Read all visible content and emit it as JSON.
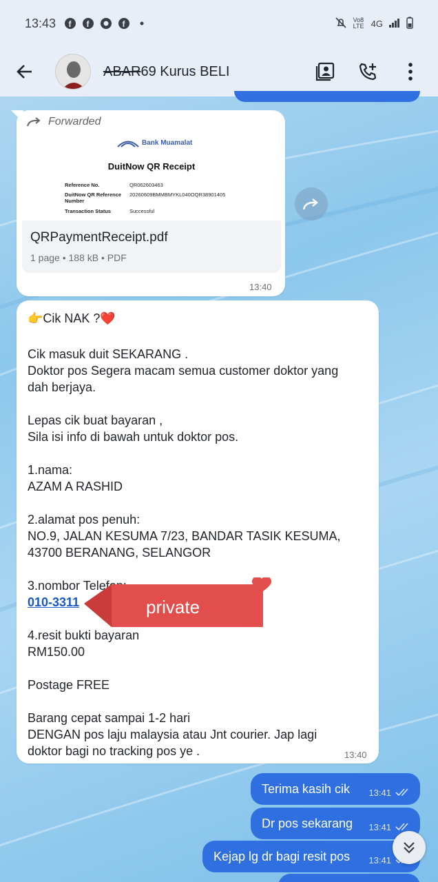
{
  "status_bar": {
    "time": "13:43",
    "network": "4G",
    "volte": "Vo8 LTE"
  },
  "header": {
    "title_strike": "ABAR",
    "title_rest": "69 Kurus BELI"
  },
  "messages": {
    "pdf": {
      "forwarded_label": "Forwarded",
      "bank_name": "Bank Muamalat",
      "receipt_title": "DuitNow QR Receipt",
      "rows": [
        {
          "k": "Reference No.",
          "v": "QR062603463"
        },
        {
          "k": "DuitNow QR Reference Number",
          "v": "20260609BMMBMYKL040OQR38901405"
        },
        {
          "k": "Transaction Status",
          "v": "Successful"
        }
      ],
      "file_name": "QRPaymentReceipt.pdf",
      "file_meta": "1 page • 188 kB • PDF",
      "time": "13:40"
    },
    "text": {
      "lines": [
        "👉Cik NAK ?❤️",
        " Cik masuk duit  SEKARANG .",
        " Doktor pos  Segera macam semua customer doktor yang",
        "dah berjaya.",
        "Lepas cik buat bayaran ,",
        "Sila isi info di bawah untuk doktor pos.",
        "1.nama:",
        "AZAM A RASHID",
        "2.alamat pos penuh:",
        "NO.9, JALAN KESUMA 7/23, BANDAR TASIK KESUMA,",
        "43700 BERANANG, SELANGOR",
        "3.nombor Telefon:",
        "4.resit bukti bayaran",
        "RM150.00",
        "Postage FREE",
        "Barang cepat sampai 1-2 hari",
        "DENGAN pos laju malaysia atau Jnt courier. Jap lagi",
        "doktor bagi no tracking pos ye ."
      ],
      "phone": "010-3311",
      "private_label": "private",
      "time": "13:40"
    },
    "outgoing": [
      {
        "text": "Terima kasih cik",
        "time": "13:41"
      },
      {
        "text": "Dr pos sekarang",
        "time": "13:41"
      },
      {
        "text": "Kejap lg dr bagi resit pos",
        "time": "13:41"
      }
    ]
  }
}
